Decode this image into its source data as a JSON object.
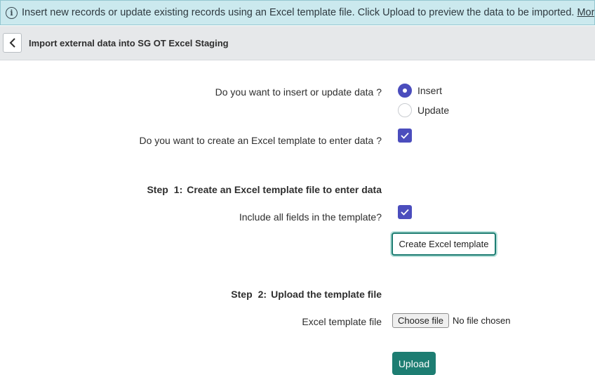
{
  "banner": {
    "text": "Insert new records or update existing records using an Excel template file. Click Upload to preview the data to be imported.",
    "link": "More Info"
  },
  "header": {
    "title": "Import external data into SG OT Excel Staging"
  },
  "form": {
    "insert_update_question": "Do you want to insert or update data ?",
    "options": [
      "Insert",
      "Update"
    ],
    "selected_option": "Insert",
    "create_template_question": "Do you want to create an Excel template to enter data ?",
    "create_template_checked": true,
    "step1": {
      "word": "Step",
      "num": "1:",
      "title": "Create an Excel template file to enter data"
    },
    "include_fields_question": "Include all fields in the template?",
    "include_fields_checked": true,
    "create_button": "Create Excel template",
    "step2": {
      "word": "Step",
      "num": "2:",
      "title": "Upload the template file"
    },
    "file_label": "Excel template file",
    "choose_file_button": "Choose file",
    "file_status": "No file chosen",
    "upload_button": "Upload"
  },
  "colors": {
    "accent": "#4b4dbd",
    "primary": "#1d7d72",
    "banner_bg": "#cbe9ee",
    "header_bg": "#e6e8ea"
  }
}
